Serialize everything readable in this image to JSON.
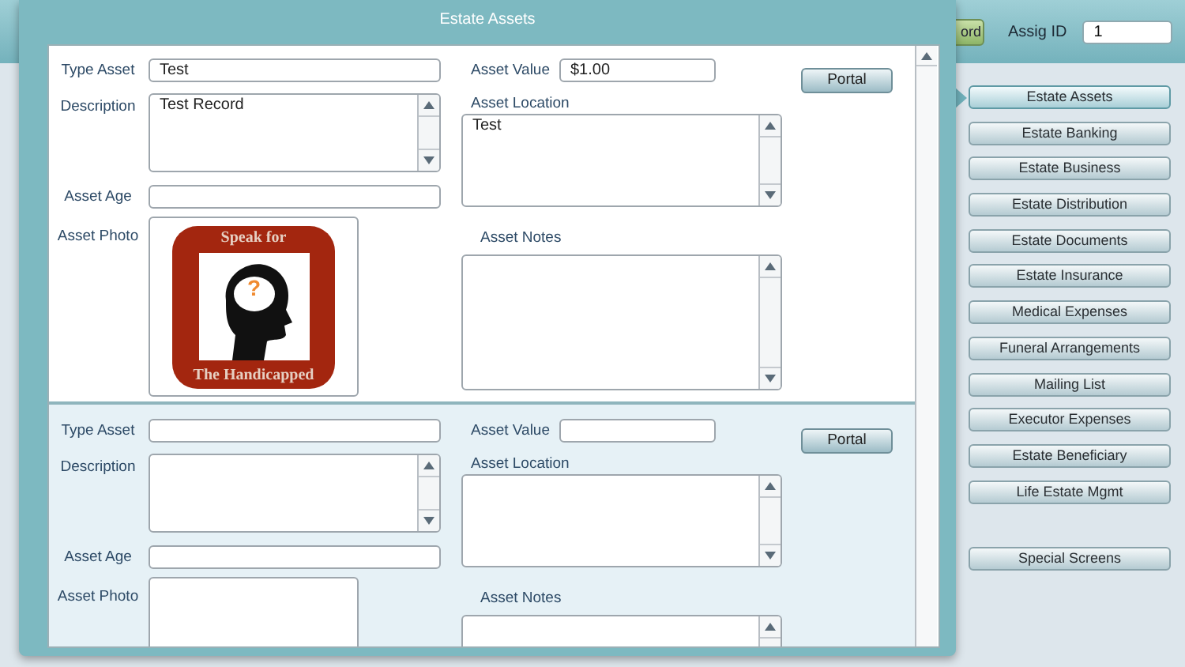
{
  "window": {
    "title": "Estate Assets"
  },
  "header": {
    "button_label": "ord",
    "id_label": "Assig ID",
    "id_value": "1"
  },
  "records": [
    {
      "selected": false,
      "type_asset_label": "Type Asset",
      "type_asset": "Test",
      "description_label": "Description",
      "description": "Test Record",
      "asset_age_label": "Asset Age",
      "asset_photo_label": "Asset Photo",
      "photo": {
        "top_text": "Speak for",
        "mark": "?",
        "bottom_text": "The Handicapped"
      },
      "asset_value_label": "Asset Value",
      "asset_value": "$1.00",
      "asset_location_label": "Asset Location",
      "asset_location": "Test",
      "asset_notes_label": "Asset Notes",
      "portal_button": "Portal"
    },
    {
      "selected": true,
      "type_asset_label": "Type Asset",
      "description_label": "Description",
      "asset_age_label": "Asset Age",
      "asset_photo_label": "Asset Photo",
      "asset_value_label": "Asset Value",
      "asset_location_label": "Asset Location",
      "asset_notes_label": "Asset Notes",
      "portal_button": "Portal"
    }
  ],
  "sidebar": {
    "items": [
      {
        "label": "Estate Assets",
        "selected": true
      },
      {
        "label": "Estate Banking",
        "selected": false
      },
      {
        "label": "Estate Business",
        "selected": false
      },
      {
        "label": "Estate Distribution",
        "selected": false
      },
      {
        "label": "Estate Documents",
        "selected": false
      },
      {
        "label": "Estate Insurance",
        "selected": false
      },
      {
        "label": "Medical Expenses",
        "selected": false
      },
      {
        "label": "Funeral Arrangements",
        "selected": false
      },
      {
        "label": "Mailing List",
        "selected": false
      },
      {
        "label": "Executor Expenses",
        "selected": false
      },
      {
        "label": "Estate Beneficiary",
        "selected": false
      },
      {
        "label": "Life Estate Mgmt",
        "selected": false
      }
    ],
    "special_items": [
      {
        "label": "Special Screens",
        "selected": false
      }
    ]
  }
}
